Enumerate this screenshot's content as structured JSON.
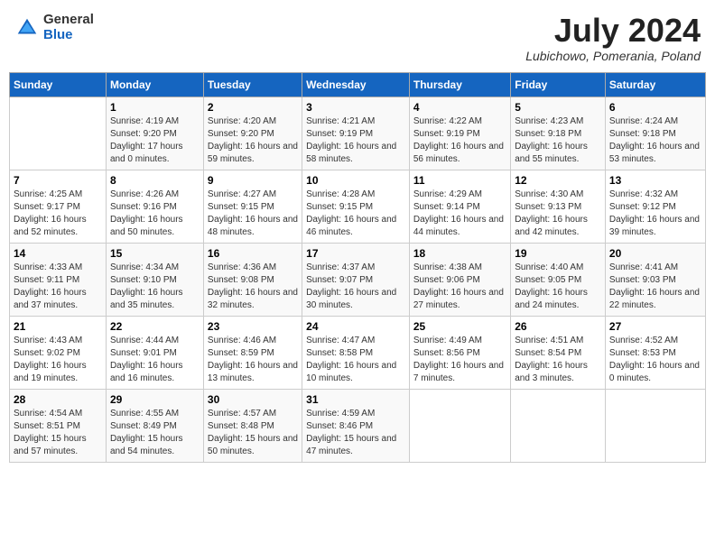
{
  "header": {
    "logo": {
      "general": "General",
      "blue": "Blue"
    },
    "title": "July 2024",
    "location": "Lubichowo, Pomerania, Poland"
  },
  "weekdays": [
    "Sunday",
    "Monday",
    "Tuesday",
    "Wednesday",
    "Thursday",
    "Friday",
    "Saturday"
  ],
  "weeks": [
    [
      {
        "day": null
      },
      {
        "day": 1,
        "sunrise": "4:19 AM",
        "sunset": "9:20 PM",
        "daylight": "17 hours and 0 minutes."
      },
      {
        "day": 2,
        "sunrise": "4:20 AM",
        "sunset": "9:20 PM",
        "daylight": "16 hours and 59 minutes."
      },
      {
        "day": 3,
        "sunrise": "4:21 AM",
        "sunset": "9:19 PM",
        "daylight": "16 hours and 58 minutes."
      },
      {
        "day": 4,
        "sunrise": "4:22 AM",
        "sunset": "9:19 PM",
        "daylight": "16 hours and 56 minutes."
      },
      {
        "day": 5,
        "sunrise": "4:23 AM",
        "sunset": "9:18 PM",
        "daylight": "16 hours and 55 minutes."
      },
      {
        "day": 6,
        "sunrise": "4:24 AM",
        "sunset": "9:18 PM",
        "daylight": "16 hours and 53 minutes."
      }
    ],
    [
      {
        "day": 7,
        "sunrise": "4:25 AM",
        "sunset": "9:17 PM",
        "daylight": "16 hours and 52 minutes."
      },
      {
        "day": 8,
        "sunrise": "4:26 AM",
        "sunset": "9:16 PM",
        "daylight": "16 hours and 50 minutes."
      },
      {
        "day": 9,
        "sunrise": "4:27 AM",
        "sunset": "9:15 PM",
        "daylight": "16 hours and 48 minutes."
      },
      {
        "day": 10,
        "sunrise": "4:28 AM",
        "sunset": "9:15 PM",
        "daylight": "16 hours and 46 minutes."
      },
      {
        "day": 11,
        "sunrise": "4:29 AM",
        "sunset": "9:14 PM",
        "daylight": "16 hours and 44 minutes."
      },
      {
        "day": 12,
        "sunrise": "4:30 AM",
        "sunset": "9:13 PM",
        "daylight": "16 hours and 42 minutes."
      },
      {
        "day": 13,
        "sunrise": "4:32 AM",
        "sunset": "9:12 PM",
        "daylight": "16 hours and 39 minutes."
      }
    ],
    [
      {
        "day": 14,
        "sunrise": "4:33 AM",
        "sunset": "9:11 PM",
        "daylight": "16 hours and 37 minutes."
      },
      {
        "day": 15,
        "sunrise": "4:34 AM",
        "sunset": "9:10 PM",
        "daylight": "16 hours and 35 minutes."
      },
      {
        "day": 16,
        "sunrise": "4:36 AM",
        "sunset": "9:08 PM",
        "daylight": "16 hours and 32 minutes."
      },
      {
        "day": 17,
        "sunrise": "4:37 AM",
        "sunset": "9:07 PM",
        "daylight": "16 hours and 30 minutes."
      },
      {
        "day": 18,
        "sunrise": "4:38 AM",
        "sunset": "9:06 PM",
        "daylight": "16 hours and 27 minutes."
      },
      {
        "day": 19,
        "sunrise": "4:40 AM",
        "sunset": "9:05 PM",
        "daylight": "16 hours and 24 minutes."
      },
      {
        "day": 20,
        "sunrise": "4:41 AM",
        "sunset": "9:03 PM",
        "daylight": "16 hours and 22 minutes."
      }
    ],
    [
      {
        "day": 21,
        "sunrise": "4:43 AM",
        "sunset": "9:02 PM",
        "daylight": "16 hours and 19 minutes."
      },
      {
        "day": 22,
        "sunrise": "4:44 AM",
        "sunset": "9:01 PM",
        "daylight": "16 hours and 16 minutes."
      },
      {
        "day": 23,
        "sunrise": "4:46 AM",
        "sunset": "8:59 PM",
        "daylight": "16 hours and 13 minutes."
      },
      {
        "day": 24,
        "sunrise": "4:47 AM",
        "sunset": "8:58 PM",
        "daylight": "16 hours and 10 minutes."
      },
      {
        "day": 25,
        "sunrise": "4:49 AM",
        "sunset": "8:56 PM",
        "daylight": "16 hours and 7 minutes."
      },
      {
        "day": 26,
        "sunrise": "4:51 AM",
        "sunset": "8:54 PM",
        "daylight": "16 hours and 3 minutes."
      },
      {
        "day": 27,
        "sunrise": "4:52 AM",
        "sunset": "8:53 PM",
        "daylight": "16 hours and 0 minutes."
      }
    ],
    [
      {
        "day": 28,
        "sunrise": "4:54 AM",
        "sunset": "8:51 PM",
        "daylight": "15 hours and 57 minutes."
      },
      {
        "day": 29,
        "sunrise": "4:55 AM",
        "sunset": "8:49 PM",
        "daylight": "15 hours and 54 minutes."
      },
      {
        "day": 30,
        "sunrise": "4:57 AM",
        "sunset": "8:48 PM",
        "daylight": "15 hours and 50 minutes."
      },
      {
        "day": 31,
        "sunrise": "4:59 AM",
        "sunset": "8:46 PM",
        "daylight": "15 hours and 47 minutes."
      },
      {
        "day": null
      },
      {
        "day": null
      },
      {
        "day": null
      }
    ]
  ]
}
